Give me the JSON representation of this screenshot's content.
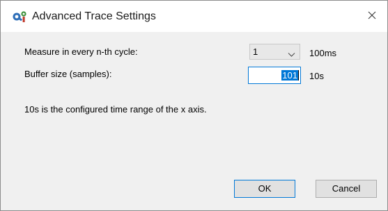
{
  "window": {
    "title": "Advanced Trace Settings",
    "close_icon": "close-icon",
    "app_icon": "trace-settings-icon"
  },
  "form": {
    "measure_label": "Measure in every n-th cycle:",
    "measure_value": "1",
    "measure_unit": "100ms",
    "buffer_label": "Buffer size (samples):",
    "buffer_value": "101",
    "buffer_unit": "10s",
    "info_text": "10s is the configured time range of the x axis."
  },
  "buttons": {
    "ok_label": "OK",
    "cancel_label": "Cancel"
  },
  "colors": {
    "accent": "#0078d7",
    "dialog_bg": "#f0f0f0",
    "button_bg": "#e1e1e1"
  }
}
